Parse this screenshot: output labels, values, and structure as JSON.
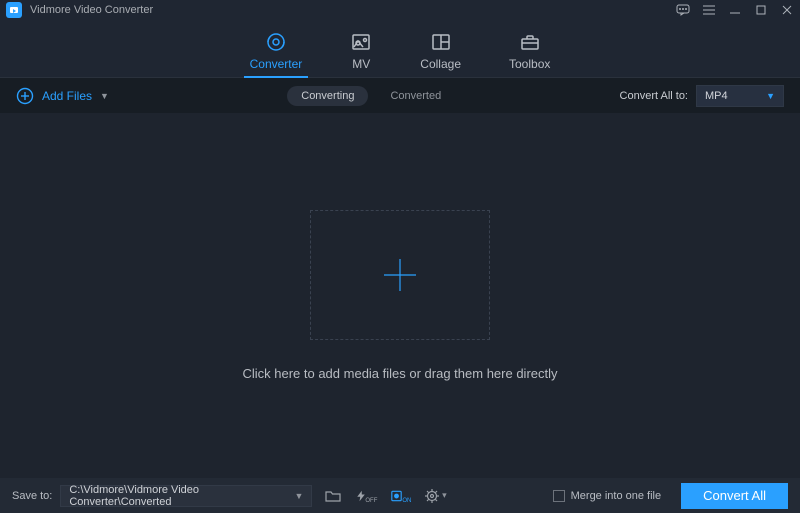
{
  "app": {
    "title": "Vidmore Video Converter"
  },
  "tabs": [
    {
      "label": "Converter"
    },
    {
      "label": "MV"
    },
    {
      "label": "Collage"
    },
    {
      "label": "Toolbox"
    }
  ],
  "subbar": {
    "add_label": "Add Files",
    "status": [
      "Converting",
      "Converted"
    ],
    "convert_all_label": "Convert All to:",
    "format_selected": "MP4"
  },
  "main": {
    "hint": "Click here to add media files or drag them here directly"
  },
  "bottom": {
    "save_label": "Save to:",
    "save_path": "C:\\Vidmore\\Vidmore Video Converter\\Converted",
    "merge_label": "Merge into one file",
    "convert_button": "Convert All"
  },
  "colors": {
    "accent": "#2aa0ff",
    "bg": "#1e242e",
    "panel": "#232a35"
  }
}
